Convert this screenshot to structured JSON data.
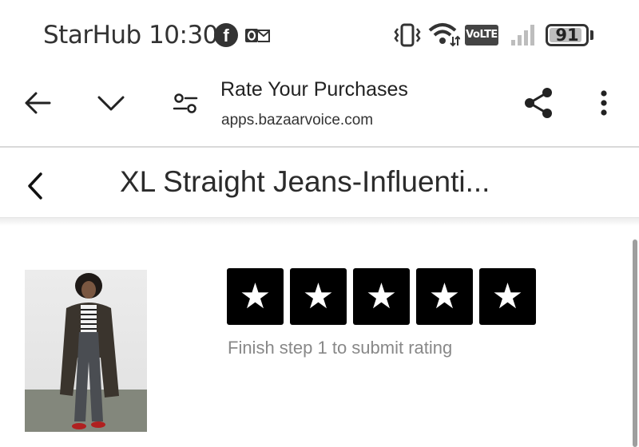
{
  "status_bar": {
    "carrier_time": "StarHub 10:30",
    "facebook_letter": "f",
    "network_badge": "VoLTE",
    "battery_level": "91",
    "battery_fraction": 0.91
  },
  "browser": {
    "page_title": "Rate Your Purchases",
    "domain": "apps.bazaarvoice.com"
  },
  "header": {
    "title": "XL Straight Jeans-Influenti..."
  },
  "rating": {
    "star_glyph": "★",
    "star_count": 5,
    "hint": "Finish step 1 to submit rating"
  },
  "icons": [
    "back-arrow-icon",
    "chevron-down-icon",
    "tune-icon",
    "share-icon",
    "more-vert-icon",
    "back-chevron-icon",
    "facebook-icon",
    "outlook-icon",
    "vibrate-icon",
    "wifi-icon",
    "signal-icon",
    "battery-icon"
  ]
}
